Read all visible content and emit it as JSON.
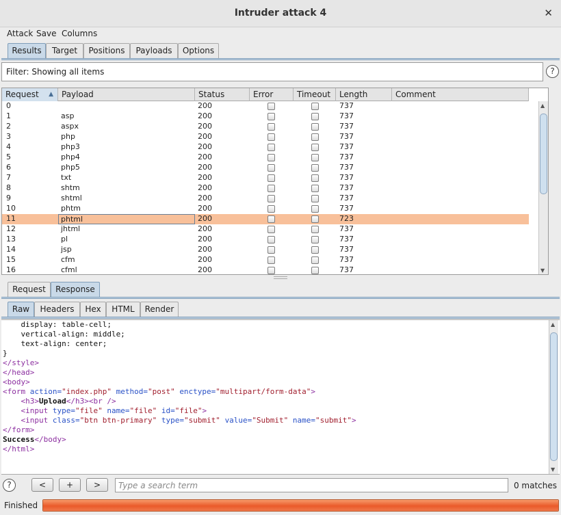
{
  "window": {
    "title": "Intruder attack 4"
  },
  "menu": [
    "Attack",
    "Save",
    "Columns"
  ],
  "main_tabs": [
    {
      "label": "Results",
      "active": true
    },
    {
      "label": "Target",
      "active": false
    },
    {
      "label": "Positions",
      "active": false
    },
    {
      "label": "Payloads",
      "active": false
    },
    {
      "label": "Options",
      "active": false
    }
  ],
  "filter": {
    "text": "Filter: Showing all items"
  },
  "help_glyph": "?",
  "sort_glyph": "▲",
  "results_table": {
    "columns": [
      "Request",
      "Payload",
      "Status",
      "Error",
      "Timeout",
      "Length",
      "Comment"
    ],
    "sorted_column": "Request",
    "selected_request": "11",
    "rows": [
      {
        "request": "0",
        "payload": "",
        "status": "200",
        "error": false,
        "timeout": false,
        "length": "737",
        "comment": ""
      },
      {
        "request": "1",
        "payload": "asp",
        "status": "200",
        "error": false,
        "timeout": false,
        "length": "737",
        "comment": ""
      },
      {
        "request": "2",
        "payload": "aspx",
        "status": "200",
        "error": false,
        "timeout": false,
        "length": "737",
        "comment": ""
      },
      {
        "request": "3",
        "payload": "php",
        "status": "200",
        "error": false,
        "timeout": false,
        "length": "737",
        "comment": ""
      },
      {
        "request": "4",
        "payload": "php3",
        "status": "200",
        "error": false,
        "timeout": false,
        "length": "737",
        "comment": ""
      },
      {
        "request": "5",
        "payload": "php4",
        "status": "200",
        "error": false,
        "timeout": false,
        "length": "737",
        "comment": ""
      },
      {
        "request": "6",
        "payload": "php5",
        "status": "200",
        "error": false,
        "timeout": false,
        "length": "737",
        "comment": ""
      },
      {
        "request": "7",
        "payload": "txt",
        "status": "200",
        "error": false,
        "timeout": false,
        "length": "737",
        "comment": ""
      },
      {
        "request": "8",
        "payload": "shtm",
        "status": "200",
        "error": false,
        "timeout": false,
        "length": "737",
        "comment": ""
      },
      {
        "request": "9",
        "payload": "shtml",
        "status": "200",
        "error": false,
        "timeout": false,
        "length": "737",
        "comment": ""
      },
      {
        "request": "10",
        "payload": "phtm",
        "status": "200",
        "error": false,
        "timeout": false,
        "length": "737",
        "comment": ""
      },
      {
        "request": "11",
        "payload": "phtml",
        "status": "200",
        "error": false,
        "timeout": false,
        "length": "723",
        "comment": ""
      },
      {
        "request": "12",
        "payload": "jhtml",
        "status": "200",
        "error": false,
        "timeout": false,
        "length": "737",
        "comment": ""
      },
      {
        "request": "13",
        "payload": "pl",
        "status": "200",
        "error": false,
        "timeout": false,
        "length": "737",
        "comment": ""
      },
      {
        "request": "14",
        "payload": "jsp",
        "status": "200",
        "error": false,
        "timeout": false,
        "length": "737",
        "comment": ""
      },
      {
        "request": "15",
        "payload": "cfm",
        "status": "200",
        "error": false,
        "timeout": false,
        "length": "737",
        "comment": ""
      },
      {
        "request": "16",
        "payload": "cfml",
        "status": "200",
        "error": false,
        "timeout": false,
        "length": "737",
        "comment": ""
      }
    ]
  },
  "detail_tabs": [
    {
      "label": "Request",
      "active": false
    },
    {
      "label": "Response",
      "active": true
    }
  ],
  "view_tabs": [
    {
      "label": "Raw",
      "active": true
    },
    {
      "label": "Headers",
      "active": false
    },
    {
      "label": "Hex",
      "active": false
    },
    {
      "label": "HTML",
      "active": false
    },
    {
      "label": "Render",
      "active": false
    }
  ],
  "response_lines": [
    [
      [
        "    display: table-cell;",
        ""
      ]
    ],
    [
      [
        "    vertical-align: middle;",
        ""
      ]
    ],
    [
      [
        "    text-align: center;",
        ""
      ]
    ],
    [
      [
        "}",
        ""
      ]
    ],
    [
      [
        "</style>",
        "tg"
      ]
    ],
    [
      [
        "</head>",
        "tg"
      ]
    ],
    [
      [
        "<body>",
        "tg"
      ]
    ],
    [
      [
        "<form ",
        "tg"
      ],
      [
        "action=",
        "at"
      ],
      [
        "\"index.php\" ",
        "vl"
      ],
      [
        "method=",
        "at"
      ],
      [
        "\"post\" ",
        "vl"
      ],
      [
        "enctype=",
        "at"
      ],
      [
        "\"multipart/form-data\"",
        "vl"
      ],
      [
        ">",
        "tg"
      ]
    ],
    [
      [
        "    ",
        ""
      ],
      [
        "<h3>",
        "tg"
      ],
      [
        "Upload",
        "bd"
      ],
      [
        "</h3>",
        "tg"
      ],
      [
        "<br />",
        "tg"
      ]
    ],
    [
      [
        "    ",
        ""
      ],
      [
        "<input ",
        "tg"
      ],
      [
        "type=",
        "at"
      ],
      [
        "\"file\" ",
        "vl"
      ],
      [
        "name=",
        "at"
      ],
      [
        "\"file\" ",
        "vl"
      ],
      [
        "id=",
        "at"
      ],
      [
        "\"file\"",
        "vl"
      ],
      [
        ">",
        "tg"
      ]
    ],
    [
      [
        "    ",
        ""
      ],
      [
        "<input ",
        "tg"
      ],
      [
        "class=",
        "at"
      ],
      [
        "\"btn btn-primary\" ",
        "vl"
      ],
      [
        "type=",
        "at"
      ],
      [
        "\"submit\" ",
        "vl"
      ],
      [
        "value=",
        "at"
      ],
      [
        "\"Submit\" ",
        "vl"
      ],
      [
        "name=",
        "at"
      ],
      [
        "\"submit\"",
        "vl"
      ],
      [
        ">",
        "tg"
      ]
    ],
    [
      [
        "</form>",
        "tg"
      ]
    ],
    [
      [
        "Success",
        "bd"
      ],
      [
        "</body>",
        "tg"
      ]
    ],
    [
      [
        "</html>",
        "tg"
      ]
    ]
  ],
  "search": {
    "placeholder": "Type a search term",
    "value": "",
    "prev": "<",
    "add": "+",
    "next": ">",
    "matches": "0 matches"
  },
  "status": {
    "label": "Finished",
    "progress": 1.0
  },
  "colors": {
    "selected_row": "#f8c09a",
    "progress_fill": "#ea5a2a",
    "tab_active": "#c9d9e8"
  }
}
